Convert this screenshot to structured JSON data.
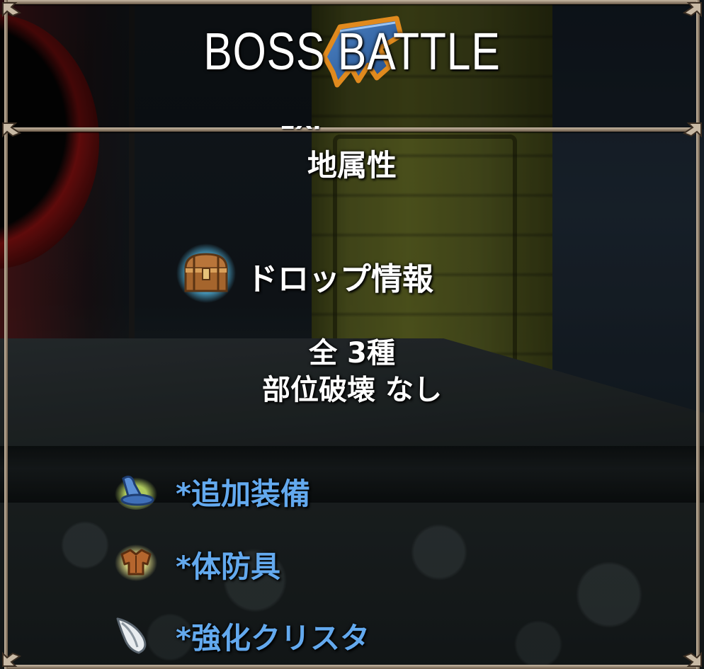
{
  "header": {
    "title": "BOSS  BATTLE"
  },
  "boss_info": {
    "cut_off_text": "EXP ・・・",
    "attribute": "地属性"
  },
  "drop_info": {
    "title": "ドロップ情報",
    "chest_icon": "treasure-chest-icon",
    "total": "全  3種",
    "part_break": "部位破壊  なし",
    "items": [
      {
        "label": "*追加装備",
        "icon": "wizard-hat-icon"
      },
      {
        "label": "*体防具",
        "icon": "body-armor-icon"
      },
      {
        "label": "*強化クリスタ",
        "icon": "crystal-shard-icon"
      }
    ]
  },
  "colors": {
    "item_label": "#63a9ee",
    "text": "#ffffff",
    "frame": "#c8b9a4"
  }
}
